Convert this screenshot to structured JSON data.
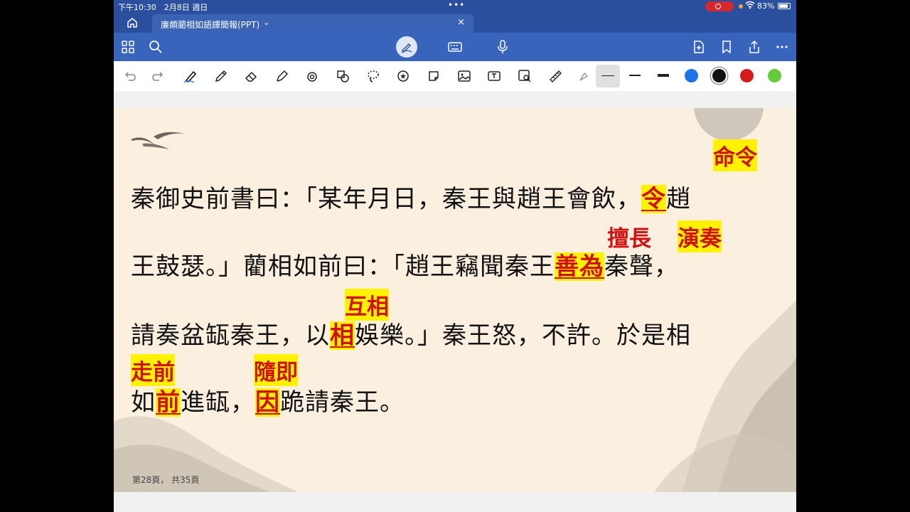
{
  "status": {
    "time": "下午10:30　2月8日 週日",
    "battery": "83%"
  },
  "tab": {
    "title": "廉頗藺相如語譯簡報(PPT)",
    "close": "×"
  },
  "draw_colors": [
    "#1a73e8",
    "#111111",
    "#d61b1b",
    "#62cc3a"
  ],
  "slide": {
    "line1": {
      "a": "秦御史前書曰：「某年月日，秦王與趙王會飲，",
      "hl": "令",
      "b": "趙"
    },
    "line2": {
      "a": "王鼓瑟。」藺相如前曰：「趙王竊聞秦王",
      "hl": "善為",
      "b": "秦聲，"
    },
    "line3": {
      "a": "請奏盆缻秦王，以",
      "hl": "相",
      "b": "娛樂。」秦王怒，不許。於是相"
    },
    "line4": {
      "a": "如",
      "hl1": "前",
      "b": "進缻，",
      "hl2": "因",
      "c": "跪請秦王。"
    },
    "annotations": {
      "ling": "命令",
      "shan": "擅長",
      "wei": "演奏",
      "xiang": "互相",
      "qian": "走前",
      "yin": "隨即"
    },
    "page_number": "第28頁， 共35頁"
  }
}
